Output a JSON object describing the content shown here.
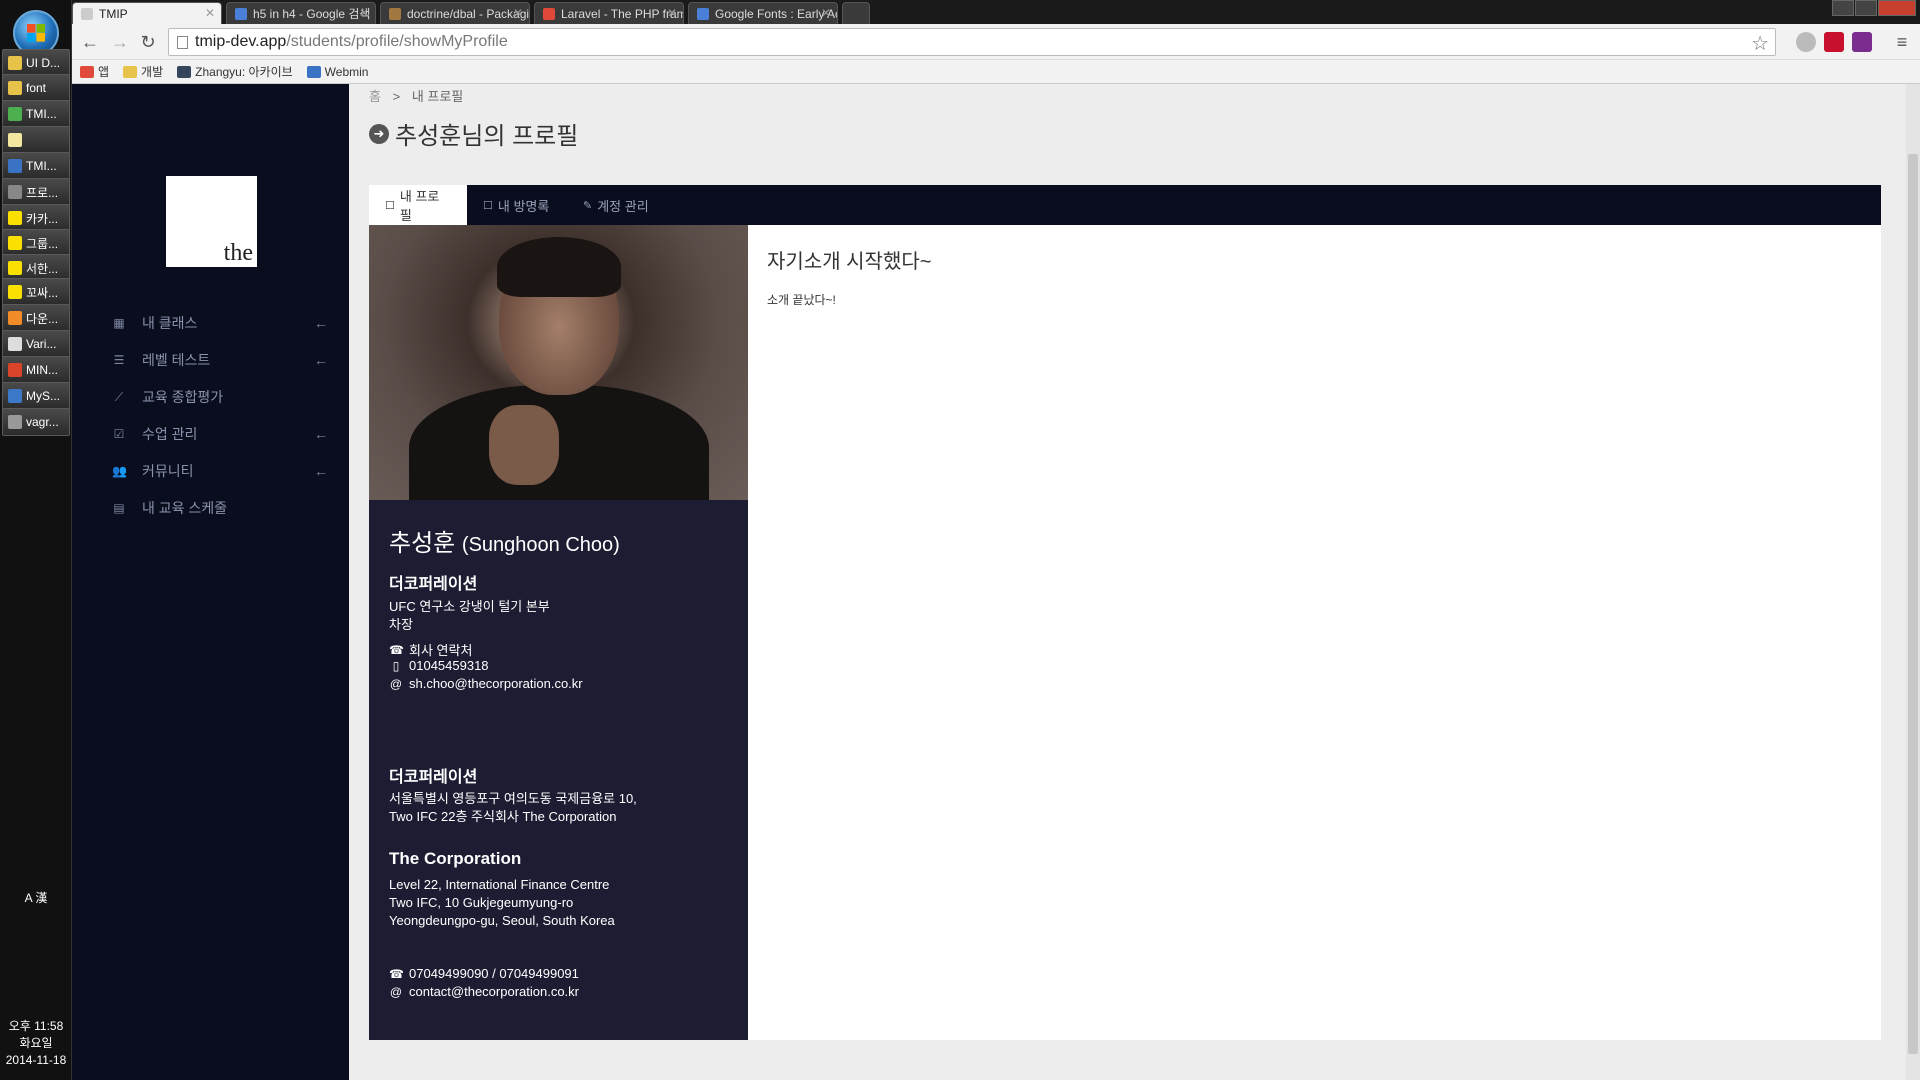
{
  "taskbar": {
    "items": [
      {
        "label": "UI D...",
        "icon": "folder-icon",
        "color": "#e8c34a"
      },
      {
        "label": "font",
        "icon": "folder-icon",
        "color": "#e8c34a"
      },
      {
        "label": "TMI...",
        "icon": "chrome-icon",
        "color": "#4caf50"
      },
      {
        "label": "",
        "icon": "notepad-icon",
        "color": "#f3e7a0"
      },
      {
        "label": "TMI...",
        "icon": "app-icon",
        "color": "#3b73c4"
      },
      {
        "label": "프로...",
        "icon": "app-icon",
        "color": "#888888"
      },
      {
        "label": "카카...",
        "icon": "kakao-icon",
        "color": "#f9e000"
      },
      {
        "label": "그룹...",
        "icon": "kakao-icon",
        "color": "#f9e000"
      },
      {
        "label": "서한...",
        "icon": "kakao-icon",
        "color": "#f9e000"
      },
      {
        "label": "꼬싸...",
        "icon": "kakao-icon",
        "color": "#f9e000"
      },
      {
        "label": "다운...",
        "icon": "download-icon",
        "color": "#f28c28"
      },
      {
        "label": "Vari...",
        "icon": "app-icon",
        "color": "#dddddd"
      },
      {
        "label": "MIN...",
        "icon": "app-icon",
        "color": "#d9442b"
      },
      {
        "label": "MyS...",
        "icon": "mysql-icon",
        "color": "#3c78c8"
      },
      {
        "label": "vagr...",
        "icon": "app-icon",
        "color": "#999999"
      }
    ],
    "clock": {
      "time": "오후 11:58",
      "day": "화요일",
      "date": "2014-11-18"
    }
  },
  "browser": {
    "tabs": [
      {
        "title": "TMIP",
        "active": true,
        "favicon_color": "#cccccc"
      },
      {
        "title": "h5 in h4 - Google 검색",
        "active": false,
        "favicon_color": "#4a7fd8"
      },
      {
        "title": "doctrine/dbal - Packagist",
        "active": false,
        "favicon_color": "#a07840"
      },
      {
        "title": "Laravel - The PHP framew",
        "active": false,
        "favicon_color": "#e0493a"
      },
      {
        "title": "Google Fonts : Early Acce",
        "active": false,
        "favicon_color": "#4a7fd8"
      }
    ],
    "url_host": "tmip-dev.app",
    "url_path": "/students/profile/showMyProfile",
    "bookmarks": [
      {
        "label": "앱",
        "icon": "apps-icon"
      },
      {
        "label": "개발",
        "icon": "folder-icon"
      },
      {
        "label": "Zhangyu: 아카이브",
        "icon": "tumblr-icon"
      },
      {
        "label": "Webmin",
        "icon": "webmin-icon"
      }
    ]
  },
  "sidebar": {
    "logo_text": "the",
    "menu": [
      {
        "label": "내 클래스",
        "icon": "grid-icon",
        "arrow": true
      },
      {
        "label": "레벨 테스트",
        "icon": "list-icon",
        "arrow": true
      },
      {
        "label": "교육 종합평가",
        "icon": "chart-icon",
        "arrow": false
      },
      {
        "label": "수업 관리",
        "icon": "checkbox-icon",
        "arrow": true
      },
      {
        "label": "커뮤니티",
        "icon": "users-icon",
        "arrow": true
      },
      {
        "label": "내 교육 스케줄",
        "icon": "calendar-icon",
        "arrow": false
      }
    ]
  },
  "content": {
    "breadcrumb": {
      "home": "홈",
      "sep": ">",
      "current": "내 프로필"
    },
    "title": "추성훈님의 프로필",
    "tabs": [
      {
        "label": "내 프로필",
        "active": true
      },
      {
        "label": "내 방명록",
        "active": false
      },
      {
        "label": "계정 관리",
        "active": false
      }
    ],
    "card": {
      "name_ko": "추성훈",
      "name_en": "(Sunghoon Choo)",
      "company": "더코퍼레이션",
      "department": "UFC 연구소 강냉이 털기 본부",
      "position": "차장",
      "phone_label": "회사 연락처",
      "mobile": "01045459318",
      "email": "sh.choo@thecorporation.co.kr",
      "company_ko": "더코퍼레이션",
      "addr_ko_1": "서울특별시 영등포구 여의도동 국제금융로 10,",
      "addr_ko_2": "Two IFC 22층 주식회사 The Corporation",
      "company_en": "The Corporation",
      "addr_en_1": "Level 22, International Finance Centre",
      "addr_en_2": "Two IFC, 10 Gukjegeumyung-ro",
      "addr_en_3": "Yeongdeungpo-gu, Seoul, South Korea",
      "company_phone": "07049499090 / 07049499091",
      "company_email": "contact@thecorporation.co.kr"
    },
    "intro_title": "자기소개 시작했다~",
    "intro_body": "소개 끝났다~!"
  }
}
